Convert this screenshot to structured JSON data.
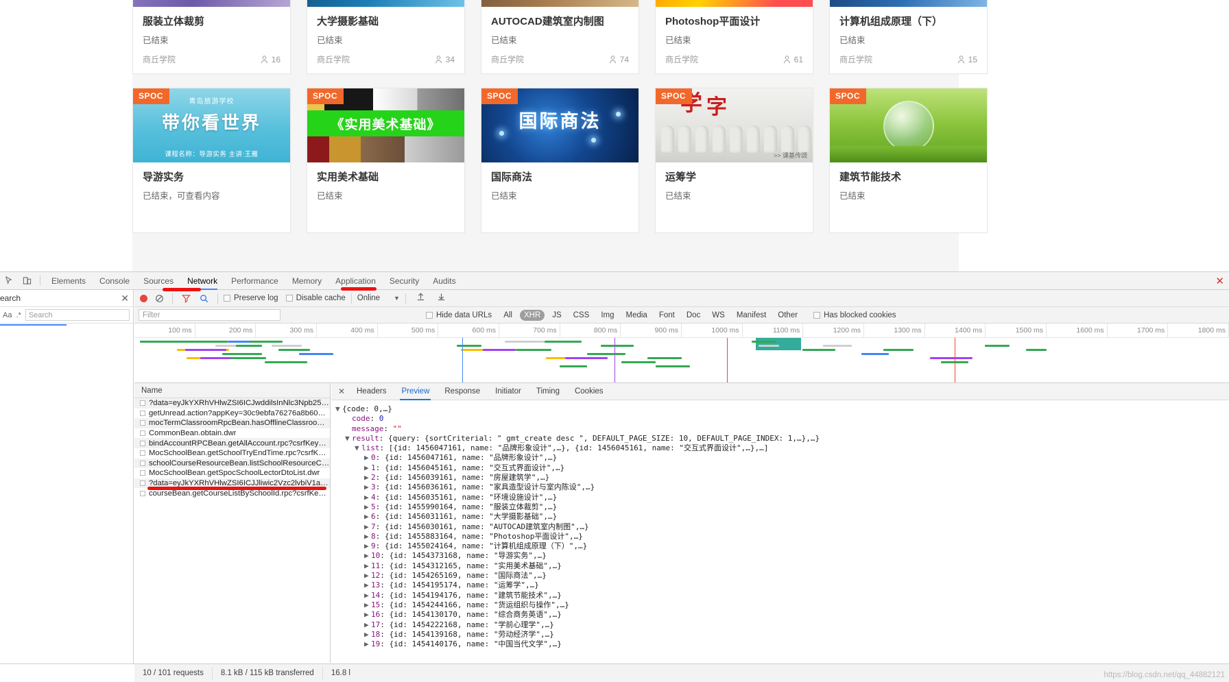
{
  "page": {
    "courses_row1": [
      {
        "title": "服装立体裁剪",
        "status": "已结束",
        "school": "商丘学院",
        "count": "16",
        "thumb": "th-generic-a"
      },
      {
        "title": "大学摄影基础",
        "status": "已结束",
        "school": "商丘学院",
        "count": "34",
        "thumb": "th-generic-b"
      },
      {
        "title": "AUTOCAD建筑室内制图",
        "status": "已结束",
        "school": "商丘学院",
        "count": "74",
        "thumb": "th-generic-c"
      },
      {
        "title": "Photoshop平面设计",
        "status": "已结束",
        "school": "商丘学院",
        "count": "61",
        "thumb": "th-generic-d"
      },
      {
        "title": "计算机组成原理（下）",
        "status": "已结束",
        "school": "商丘学院",
        "count": "15",
        "thumb": "th-generic-e"
      }
    ],
    "courses_row2": [
      {
        "title": "导游实务",
        "status": "已结束，可查看内容",
        "badge": "SPOC",
        "thumb": "th-daoyou",
        "art": {
          "line0": "青岛旅游学校",
          "line1": "带你看世界",
          "line2": "课程名称：导游实务  主讲:王雁"
        }
      },
      {
        "title": "实用美术基础",
        "status": "已结束",
        "badge": "SPOC",
        "thumb": "th-meishu",
        "art": {
          "band": "《实用美术基础》"
        }
      },
      {
        "title": "国际商法",
        "status": "已结束",
        "badge": "SPOC",
        "thumb": "th-shangfa",
        "art": {
          "line1": "国际商法"
        }
      },
      {
        "title": "运筹学",
        "status": "已结束",
        "badge": "SPOC",
        "thumb": "th-yunchou",
        "art": {
          "red1": "学",
          "red2": "字",
          "sub": ">>  课基传颂"
        }
      },
      {
        "title": "建筑节能技术",
        "status": "已结束",
        "badge": "SPOC",
        "thumb": "th-jieneng",
        "art": {}
      }
    ]
  },
  "devtools": {
    "tabs": [
      {
        "label": "Elements",
        "active": false
      },
      {
        "label": "Console",
        "active": false
      },
      {
        "label": "Sources",
        "active": false
      },
      {
        "label": "Network",
        "active": true
      },
      {
        "label": "Performance",
        "active": false
      },
      {
        "label": "Memory",
        "active": false
      },
      {
        "label": "Application",
        "active": false
      },
      {
        "label": "Security",
        "active": false
      },
      {
        "label": "Audits",
        "active": false
      }
    ],
    "close_label": "✕",
    "inspect_icon": "inspect-cursor-icon",
    "device_icon": "device-toolbar-icon",
    "search_pane": {
      "title": "Search",
      "close_label": "✕",
      "match_case_label": "Aa",
      "regex_label": ".*",
      "input_value": "",
      "input_placeholder": "Search",
      "refresh_icon": "refresh-icon",
      "clear_icon": "clear-icon"
    },
    "network_toolbar": {
      "record_icon": "record-stop-icon",
      "clear_icon": "clear-requests-icon",
      "filter_icon": "funnel-filter-icon",
      "search_icon": "search-icon",
      "preserve_log_label": "Preserve log",
      "preserve_log_checked": false,
      "disable_cache_label": "Disable cache",
      "disable_cache_checked": false,
      "throttling_value": "Online",
      "chevron_icon": "chevron-down-icon",
      "import_icon": "import-har-icon",
      "export_icon": "export-har-icon"
    },
    "filter_bar": {
      "filter_value": "",
      "filter_placeholder": "Filter",
      "hide_data_urls_label": "Hide data URLs",
      "hide_data_urls_checked": false,
      "types": [
        {
          "label": "All",
          "on": false
        },
        {
          "label": "XHR",
          "on": true
        },
        {
          "label": "JS",
          "on": false
        },
        {
          "label": "CSS",
          "on": false
        },
        {
          "label": "Img",
          "on": false
        },
        {
          "label": "Media",
          "on": false
        },
        {
          "label": "Font",
          "on": false
        },
        {
          "label": "Doc",
          "on": false
        },
        {
          "label": "WS",
          "on": false
        },
        {
          "label": "Manifest",
          "on": false
        },
        {
          "label": "Other",
          "on": false
        }
      ],
      "has_blocked_cookies_label": "Has blocked cookies",
      "has_blocked_cookies_checked": false
    },
    "overview_ticks": [
      "100 ms",
      "200 ms",
      "300 ms",
      "400 ms",
      "500 ms",
      "600 ms",
      "700 ms",
      "800 ms",
      "900 ms",
      "1000 ms",
      "1100 ms",
      "1200 ms",
      "1300 ms",
      "1400 ms",
      "1500 ms",
      "1600 ms",
      "1700 ms",
      "1800 ms"
    ],
    "requests": {
      "column_header": "Name",
      "rows": [
        "?data=eyJkYXRhVHlwZSI6ICJwddilsInNlc3Npb25Vd...",
        "getUnread.action?appKey=30c9ebfa76276a8b6018...",
        "mocTermClassroomRpcBean.hasOfflineClassroom.r...",
        "CommonBean.obtain.dwr",
        "bindAccountRPCBean.getAllAccount.rpc?csrfKey=5...",
        "MocSchoolBean.getSchoolTryEndTime.rpc?csrfKey=...",
        "schoolCourseResourceBean.listSchoolResourceCate...",
        "MocSchoolBean.getSpocSchoolLectorDtoList.dwr",
        "?data=eyJkYXRhVHlwZSI6ICJJliwic2Vzc2lvbiV1aWQi...",
        "courseBean.getCourseListBySchoolId.rpc?csrfKey=5..."
      ],
      "selected_index": 9
    },
    "detail": {
      "close_label": "✕",
      "tabs": [
        {
          "label": "Headers",
          "active": false
        },
        {
          "label": "Preview",
          "active": true
        },
        {
          "label": "Response",
          "active": false
        },
        {
          "label": "Initiator",
          "active": false
        },
        {
          "label": "Timing",
          "active": false
        },
        {
          "label": "Cookies",
          "active": false
        }
      ],
      "json_lines": [
        {
          "indent": 0,
          "tri": "▼",
          "parts": [
            {
              "t": "{code: 0,…}",
              "c": "k-plain"
            }
          ]
        },
        {
          "indent": 1,
          "tri": "",
          "parts": [
            {
              "t": "code",
              "c": "k-purple"
            },
            {
              "t": ": ",
              "c": "k-plain"
            },
            {
              "t": "0",
              "c": "k-blue"
            }
          ]
        },
        {
          "indent": 1,
          "tri": "",
          "parts": [
            {
              "t": "message",
              "c": "k-purple"
            },
            {
              "t": ": ",
              "c": "k-plain"
            },
            {
              "t": "\"\"",
              "c": "k-red"
            }
          ]
        },
        {
          "indent": 1,
          "tri": "▼",
          "parts": [
            {
              "t": "result",
              "c": "k-purple"
            },
            {
              "t": ": {query: {sortCriterial: \" gmt_create desc \", DEFAULT_PAGE_SIZE: 10, DEFAULT_PAGE_INDEX: 1,…},…}",
              "c": "k-plain"
            }
          ]
        },
        {
          "indent": 2,
          "tri": "▼",
          "parts": [
            {
              "t": "list",
              "c": "k-purple"
            },
            {
              "t": ": [{id: 1456047161, name: \"品牌形象设计\",…}, {id: 1456045161, name: \"交互式界面设计\",…},…]",
              "c": "k-plain"
            }
          ]
        },
        {
          "indent": 3,
          "tri": "▶",
          "parts": [
            {
              "t": "0",
              "c": "k-purple"
            },
            {
              "t": ": {id: 1456047161, name: \"品牌形象设计\",…}",
              "c": "k-plain"
            }
          ]
        },
        {
          "indent": 3,
          "tri": "▶",
          "parts": [
            {
              "t": "1",
              "c": "k-purple"
            },
            {
              "t": ": {id: 1456045161, name: \"交互式界面设计\",…}",
              "c": "k-plain"
            }
          ]
        },
        {
          "indent": 3,
          "tri": "▶",
          "parts": [
            {
              "t": "2",
              "c": "k-purple"
            },
            {
              "t": ": {id: 1456039161, name: \"房屋建筑学\",…}",
              "c": "k-plain"
            }
          ]
        },
        {
          "indent": 3,
          "tri": "▶",
          "parts": [
            {
              "t": "3",
              "c": "k-purple"
            },
            {
              "t": ": {id: 1456036161, name: \"家具造型设计与室内陈设\",…}",
              "c": "k-plain"
            }
          ]
        },
        {
          "indent": 3,
          "tri": "▶",
          "parts": [
            {
              "t": "4",
              "c": "k-purple"
            },
            {
              "t": ": {id: 1456035161, name: \"环境设施设计\",…}",
              "c": "k-plain"
            }
          ]
        },
        {
          "indent": 3,
          "tri": "▶",
          "parts": [
            {
              "t": "5",
              "c": "k-purple"
            },
            {
              "t": ": {id: 1455990164, name: \"服装立体裁剪\",…}",
              "c": "k-plain"
            }
          ]
        },
        {
          "indent": 3,
          "tri": "▶",
          "parts": [
            {
              "t": "6",
              "c": "k-purple"
            },
            {
              "t": ": {id: 1456031161, name: \"大学摄影基础\",…}",
              "c": "k-plain"
            }
          ]
        },
        {
          "indent": 3,
          "tri": "▶",
          "parts": [
            {
              "t": "7",
              "c": "k-purple"
            },
            {
              "t": ": {id: 1456030161, name: \"AUTOCAD建筑室内制图\",…}",
              "c": "k-plain"
            }
          ]
        },
        {
          "indent": 3,
          "tri": "▶",
          "parts": [
            {
              "t": "8",
              "c": "k-purple"
            },
            {
              "t": ": {id: 1455883164, name: \"Photoshop平面设计\",…}",
              "c": "k-plain"
            }
          ]
        },
        {
          "indent": 3,
          "tri": "▶",
          "parts": [
            {
              "t": "9",
              "c": "k-purple"
            },
            {
              "t": ": {id: 1455024164, name: \"计算机组成原理（下）\",…}",
              "c": "k-plain"
            }
          ]
        },
        {
          "indent": 3,
          "tri": "▶",
          "parts": [
            {
              "t": "10",
              "c": "k-purple"
            },
            {
              "t": ": {id: 1454373168, name: \"导游实务\",…}",
              "c": "k-plain"
            }
          ]
        },
        {
          "indent": 3,
          "tri": "▶",
          "parts": [
            {
              "t": "11",
              "c": "k-purple"
            },
            {
              "t": ": {id: 1454312165, name: \"实用美术基础\",…}",
              "c": "k-plain"
            }
          ]
        },
        {
          "indent": 3,
          "tri": "▶",
          "parts": [
            {
              "t": "12",
              "c": "k-purple"
            },
            {
              "t": ": {id: 1454265169, name: \"国际商法\",…}",
              "c": "k-plain"
            }
          ]
        },
        {
          "indent": 3,
          "tri": "▶",
          "parts": [
            {
              "t": "13",
              "c": "k-purple"
            },
            {
              "t": ": {id: 1454195174, name: \"运筹学\",…}",
              "c": "k-plain"
            }
          ]
        },
        {
          "indent": 3,
          "tri": "▶",
          "parts": [
            {
              "t": "14",
              "c": "k-purple"
            },
            {
              "t": ": {id: 1454194176, name: \"建筑节能技术\",…}",
              "c": "k-plain"
            }
          ]
        },
        {
          "indent": 3,
          "tri": "▶",
          "parts": [
            {
              "t": "15",
              "c": "k-purple"
            },
            {
              "t": ": {id: 1454244166, name: \"货运组织与操作\",…}",
              "c": "k-plain"
            }
          ]
        },
        {
          "indent": 3,
          "tri": "▶",
          "parts": [
            {
              "t": "16",
              "c": "k-purple"
            },
            {
              "t": ": {id: 1454130170, name: \"综合商务英语\",…}",
              "c": "k-plain"
            }
          ]
        },
        {
          "indent": 3,
          "tri": "▶",
          "parts": [
            {
              "t": "17",
              "c": "k-purple"
            },
            {
              "t": ": {id: 1454222168, name: \"学前心理学\",…}",
              "c": "k-plain"
            }
          ]
        },
        {
          "indent": 3,
          "tri": "▶",
          "parts": [
            {
              "t": "18",
              "c": "k-purple"
            },
            {
              "t": ": {id: 1454139168, name: \"劳动经济学\",…}",
              "c": "k-plain"
            }
          ]
        },
        {
          "indent": 3,
          "tri": "▶",
          "parts": [
            {
              "t": "19",
              "c": "k-purple"
            },
            {
              "t": ": {id: 1454140176, name: \"中国当代文学\",…}",
              "c": "k-plain"
            }
          ]
        }
      ]
    },
    "status_bar": {
      "requests": "10 / 101 requests",
      "transferred": "8.1 kB / 115 kB transferred",
      "finish": "16.8 l"
    },
    "watermark": "https://blog.csdn.net/qq_44882121"
  },
  "colors": {
    "accent_blue": "#1a73e8",
    "record_red": "#e8453c",
    "spoc_orange": "#f2682a",
    "marker_red": "#ee1111",
    "xhr_pill": "#9e9e9e"
  }
}
